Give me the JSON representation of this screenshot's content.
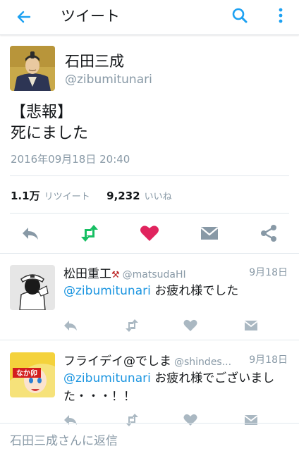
{
  "topbar": {
    "title": "ツイート"
  },
  "tweet": {
    "name": "石田三成",
    "handle": "@zibumitunari",
    "body_line1": "【悲報】",
    "body_line2": "死にました",
    "timestamp": "2016年09月18日 20:40",
    "retweet_count": "1.1万",
    "retweet_label": "リツイート",
    "like_count": "9,232",
    "like_label": "いいね"
  },
  "replies": [
    {
      "name": "松田重工",
      "handle": "@matsudaHI",
      "date": "9月18日",
      "mention": "@zibumitunari",
      "text": " お疲れ様でした"
    },
    {
      "name": "フライデイ@でしま",
      "handle": "@shindes...",
      "date": "9月18日",
      "mention": "@zibumitunari",
      "text": " お疲れ様でございました・・・！！",
      "avatar_text": "なか卯"
    }
  ],
  "composer": {
    "placeholder": "石田三成さんに返信"
  },
  "colors": {
    "accent": "#1da1f2",
    "retweet": "#17bf63",
    "like": "#e0245e",
    "icon": "#8899a6"
  }
}
